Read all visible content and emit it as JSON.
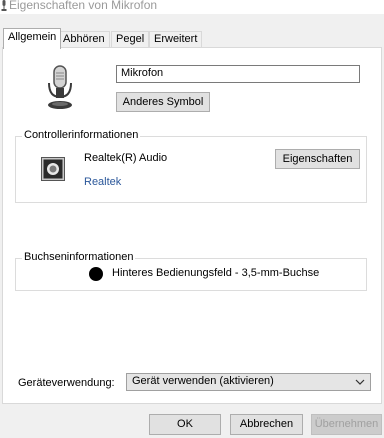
{
  "window": {
    "title": "Eigenschaften von Mikrofon",
    "title_icon": "microphone-icon"
  },
  "tabs": [
    {
      "label": "Allgemein",
      "active": true
    },
    {
      "label": "Abhören",
      "active": false
    },
    {
      "label": "Pegel",
      "active": false
    },
    {
      "label": "Erweitert",
      "active": false
    }
  ],
  "device": {
    "icon": "microphone-icon",
    "name_value": "Mikrofon",
    "change_icon_label": "Anderes Symbol"
  },
  "controller": {
    "legend": "Controllerinformationen",
    "icon": "speaker-icon",
    "name": "Realtek(R) Audio",
    "vendor_link": "Realtek",
    "properties_button": "Eigenschaften"
  },
  "jack": {
    "legend": "Buchseninformationen",
    "jack_color": "#000000",
    "label": "Hinteres Bedienungsfeld - 3,5-mm-Buchse"
  },
  "usage": {
    "label": "Geräteverwendung:",
    "selected": "Gerät verwenden (aktivieren)",
    "icon": "chevron-down-icon"
  },
  "footer": {
    "ok": "OK",
    "cancel": "Abbrechen",
    "apply": "Übernehmen"
  },
  "colors": {
    "link": "#2b579a",
    "window_bg": "#f0f0f0"
  }
}
